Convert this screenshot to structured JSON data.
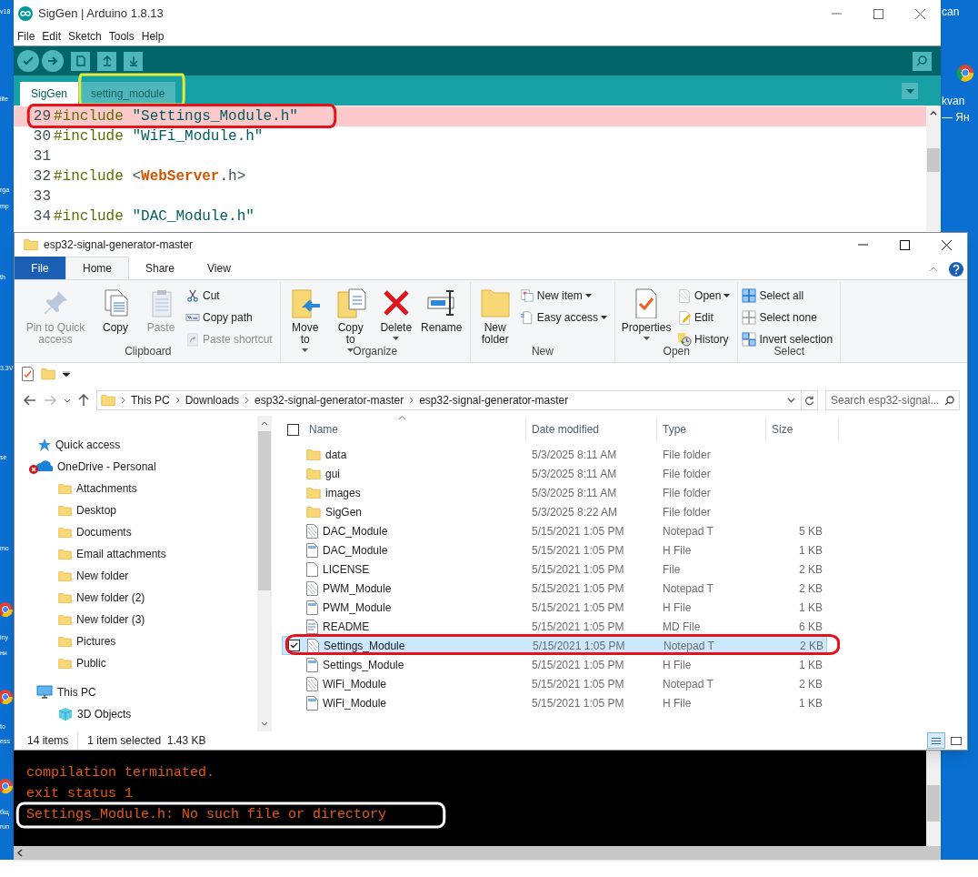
{
  "desktop": {
    "left_labels": [
      "v18",
      "ilte",
      "rga",
      "mp",
      "th",
      "3.3V",
      "se",
      "mo",
      "iny",
      "ни",
      "to",
      "ess",
      "бщ",
      "run"
    ],
    "right_labels": [
      "can",
      "kvan",
      "— Ян"
    ]
  },
  "arduino": {
    "title": "SigGen | Arduino 1.8.13",
    "menu": [
      "File",
      "Edit",
      "Sketch",
      "Tools",
      "Help"
    ],
    "tabs": [
      {
        "label": "SigGen",
        "selected": true
      },
      {
        "label": "setting_module",
        "selected": false
      }
    ],
    "lines": [
      {
        "number": "29",
        "highlighted": true,
        "tokens": [
          {
            "kind": "keyword",
            "text": "#include "
          },
          {
            "kind": "string",
            "text": "\"Settings_Module.h\""
          }
        ]
      },
      {
        "number": "30",
        "highlighted": false,
        "tokens": [
          {
            "kind": "keyword",
            "text": "#include "
          },
          {
            "kind": "string",
            "text": "\"WiFi_Module.h\""
          }
        ]
      },
      {
        "number": "31",
        "highlighted": false
      },
      {
        "number": "32",
        "highlighted": false,
        "tokens": [
          {
            "kind": "keyword",
            "text": "#include "
          },
          {
            "kind": "plain",
            "text": "<"
          },
          {
            "kind": "type",
            "text": "WebServer"
          },
          {
            "kind": "plain",
            "text": ".h>"
          }
        ]
      },
      {
        "number": "33",
        "highlighted": false
      },
      {
        "number": "34",
        "highlighted": false,
        "tokens": [
          {
            "kind": "keyword",
            "text": "#include "
          },
          {
            "kind": "string",
            "text": "\"DAC_Module.h\""
          }
        ]
      }
    ],
    "console": [
      "compilation terminated.",
      "exit status 1",
      "Settings_Module.h: No such file or directory"
    ]
  },
  "explorer": {
    "title": "esp32-signal-generator-master",
    "ribbon_tabs": [
      {
        "label": "File",
        "kind": "file",
        "selected": false
      },
      {
        "label": "Home",
        "kind": "tab",
        "selected": true
      },
      {
        "label": "Share",
        "kind": "tab",
        "selected": false
      },
      {
        "label": "View",
        "kind": "tab",
        "selected": false
      }
    ],
    "ribbon_groups": [
      {
        "label": "Clipboard",
        "items": [
          {
            "label": "Pin to Quick access",
            "kind": "large",
            "disabled": true,
            "dropdown": false
          },
          {
            "label": "Copy",
            "kind": "large",
            "disabled": false,
            "dropdown": false
          },
          {
            "label": "Paste",
            "kind": "large",
            "disabled": true,
            "dropdown": false
          },
          {
            "label": "Cut",
            "kind": "small",
            "disabled": false,
            "dropdown": false
          },
          {
            "label": "Copy path",
            "kind": "small",
            "disabled": false,
            "dropdown": false
          },
          {
            "label": "Paste shortcut",
            "kind": "small",
            "disabled": true,
            "dropdown": false
          }
        ]
      },
      {
        "label": "Organize",
        "items": [
          {
            "label": "Move to",
            "kind": "large",
            "disabled": false,
            "dropdown": true
          },
          {
            "label": "Copy to",
            "kind": "large",
            "disabled": false,
            "dropdown": true
          },
          {
            "label": "Delete",
            "kind": "large",
            "disabled": false,
            "dropdown": true
          },
          {
            "label": "Rename",
            "kind": "large",
            "disabled": false,
            "dropdown": false
          }
        ]
      },
      {
        "label": "New",
        "items": [
          {
            "label": "New folder",
            "kind": "large",
            "disabled": false,
            "dropdown": false
          },
          {
            "label": "New item",
            "kind": "small",
            "disabled": false,
            "dropdown": true
          },
          {
            "label": "Easy access",
            "kind": "small",
            "disabled": false,
            "dropdown": true
          }
        ]
      },
      {
        "label": "Open",
        "items": [
          {
            "label": "Properties",
            "kind": "large",
            "disabled": false,
            "dropdown": true
          },
          {
            "label": "Open",
            "kind": "small",
            "disabled": false,
            "dropdown": true
          },
          {
            "label": "Edit",
            "kind": "small",
            "disabled": false,
            "dropdown": false
          },
          {
            "label": "History",
            "kind": "small",
            "disabled": false,
            "dropdown": false
          }
        ]
      },
      {
        "label": "Select",
        "items": [
          {
            "label": "Select all",
            "kind": "small",
            "disabled": false,
            "dropdown": false
          },
          {
            "label": "Select none",
            "kind": "small",
            "disabled": false,
            "dropdown": false
          },
          {
            "label": "Invert selection",
            "kind": "small",
            "disabled": false,
            "dropdown": false
          }
        ]
      }
    ],
    "breadcrumb": [
      "This PC",
      "Downloads",
      "esp32-signal-generator-master",
      "esp32-signal-generator-master"
    ],
    "search": {
      "placeholder": "Search esp32-signal..."
    },
    "nav": [
      {
        "label": "Quick access",
        "kind": "star"
      },
      {
        "label": "OneDrive - Personal",
        "kind": "cloud",
        "children": [
          {
            "label": "Attachments",
            "kind": "folder"
          },
          {
            "label": "Desktop",
            "kind": "folder"
          },
          {
            "label": "Documents",
            "kind": "folder"
          },
          {
            "label": "Email attachments",
            "kind": "folder"
          },
          {
            "label": "New folder",
            "kind": "folder"
          },
          {
            "label": "New folder (2)",
            "kind": "folder"
          },
          {
            "label": "New folder (3)",
            "kind": "folder"
          },
          {
            "label": "Pictures",
            "kind": "folder"
          },
          {
            "label": "Public",
            "kind": "folder"
          }
        ]
      },
      {
        "label": "This PC",
        "kind": "pc",
        "children": [
          {
            "label": "3D Objects",
            "kind": "cube"
          }
        ]
      }
    ],
    "header_checkbox": {
      "checked": false
    },
    "columns": [
      "Name",
      "Date modified",
      "Type",
      "Size"
    ],
    "rows": [
      {
        "name": "data",
        "date": "5/3/2025 8:11 AM",
        "type": "File folder",
        "kind": "folder",
        "selected": false
      },
      {
        "name": "gui",
        "date": "5/3/2025 8:11 AM",
        "type": "File folder",
        "kind": "folder",
        "selected": false
      },
      {
        "name": "images",
        "date": "5/3/2025 8:11 AM",
        "type": "File folder",
        "kind": "folder",
        "selected": false
      },
      {
        "name": "SigGen",
        "date": "5/3/2025 8:22 AM",
        "type": "File folder",
        "kind": "folder",
        "selected": false
      },
      {
        "name": "DAC_Module",
        "date": "5/15/2021 1:05 PM",
        "type": "Notepad T",
        "size": "5 KB",
        "kind": "notepad",
        "selected": false
      },
      {
        "name": "DAC_Module",
        "date": "5/15/2021 1:05 PM",
        "type": "H File",
        "size": "1 KB",
        "kind": "header",
        "selected": false
      },
      {
        "name": "LICENSE",
        "date": "5/15/2021 1:05 PM",
        "type": "File",
        "size": "2 KB",
        "kind": "file",
        "selected": false
      },
      {
        "name": "PWM_Module",
        "date": "5/15/2021 1:05 PM",
        "type": "Notepad T",
        "size": "2 KB",
        "kind": "notepad",
        "selected": false
      },
      {
        "name": "PWM_Module",
        "date": "5/15/2021 1:05 PM",
        "type": "H File",
        "size": "1 KB",
        "kind": "header",
        "selected": false
      },
      {
        "name": "README",
        "date": "5/15/2021 1:05 PM",
        "type": "MD File",
        "size": "6 KB",
        "kind": "markdown",
        "selected": false
      },
      {
        "name": "Settings_Module",
        "date": "5/15/2021 1:05 PM",
        "type": "Notepad T",
        "size": "2 KB",
        "kind": "notepad",
        "selected": true
      },
      {
        "name": "Settings_Module",
        "date": "5/15/2021 1:05 PM",
        "type": "H File",
        "size": "1 KB",
        "kind": "header",
        "selected": false
      },
      {
        "name": "WiFi_Module",
        "date": "5/15/2021 1:05 PM",
        "type": "Notepad T",
        "size": "2 KB",
        "kind": "notepad",
        "selected": false
      },
      {
        "name": "WiFi_Module",
        "date": "5/15/2021 1:05 PM",
        "type": "H File",
        "size": "1 KB",
        "kind": "header",
        "selected": false
      }
    ],
    "status": [
      "14 items",
      "1 item selected  1.43 KB"
    ]
  }
}
